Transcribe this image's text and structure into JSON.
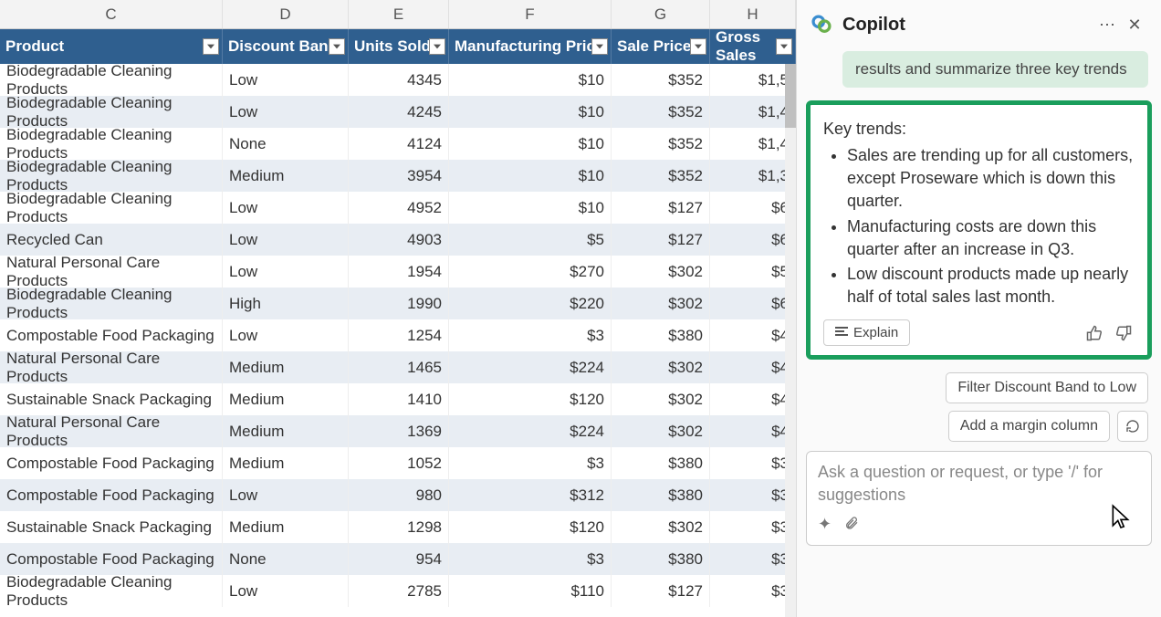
{
  "columns_letters": [
    "C",
    "D",
    "E",
    "F",
    "G",
    "H"
  ],
  "headers": [
    "Product",
    "Discount Band",
    "Units Sold",
    "Manufacturing Price",
    "Sale Price",
    "Gross Sales"
  ],
  "rows": [
    {
      "p": "Biodegradable Cleaning Products",
      "d": "Low",
      "u": "4345",
      "m": "$10",
      "s": "$352",
      "g": "$1,5"
    },
    {
      "p": "Biodegradable Cleaning Products",
      "d": "Low",
      "u": "4245",
      "m": "$10",
      "s": "$352",
      "g": "$1,4"
    },
    {
      "p": "Biodegradable Cleaning Products",
      "d": "None",
      "u": "4124",
      "m": "$10",
      "s": "$352",
      "g": "$1,4"
    },
    {
      "p": "Biodegradable Cleaning Products",
      "d": "Medium",
      "u": "3954",
      "m": "$10",
      "s": "$352",
      "g": "$1,3"
    },
    {
      "p": "Biodegradable Cleaning Products",
      "d": "Low",
      "u": "4952",
      "m": "$10",
      "s": "$127",
      "g": "$6"
    },
    {
      "p": "Recycled Can",
      "d": "Low",
      "u": "4903",
      "m": "$5",
      "s": "$127",
      "g": "$6"
    },
    {
      "p": "Natural Personal Care Products",
      "d": "Low",
      "u": "1954",
      "m": "$270",
      "s": "$302",
      "g": "$5"
    },
    {
      "p": "Biodegradable Cleaning Products",
      "d": "High",
      "u": "1990",
      "m": "$220",
      "s": "$302",
      "g": "$6"
    },
    {
      "p": "Compostable Food Packaging",
      "d": "Low",
      "u": "1254",
      "m": "$3",
      "s": "$380",
      "g": "$4"
    },
    {
      "p": "Natural Personal Care Products",
      "d": "Medium",
      "u": "1465",
      "m": "$224",
      "s": "$302",
      "g": "$4"
    },
    {
      "p": "Sustainable Snack Packaging",
      "d": "Medium",
      "u": "1410",
      "m": "$120",
      "s": "$302",
      "g": "$4"
    },
    {
      "p": "Natural Personal Care Products",
      "d": "Medium",
      "u": "1369",
      "m": "$224",
      "s": "$302",
      "g": "$4"
    },
    {
      "p": "Compostable Food Packaging",
      "d": "Medium",
      "u": "1052",
      "m": "$3",
      "s": "$380",
      "g": "$3"
    },
    {
      "p": "Compostable Food Packaging",
      "d": "Low",
      "u": "980",
      "m": "$312",
      "s": "$380",
      "g": "$3"
    },
    {
      "p": "Sustainable Snack Packaging",
      "d": "Medium",
      "u": "1298",
      "m": "$120",
      "s": "$302",
      "g": "$3"
    },
    {
      "p": "Compostable Food Packaging",
      "d": "None",
      "u": "954",
      "m": "$3",
      "s": "$380",
      "g": "$3"
    },
    {
      "p": "Biodegradable Cleaning Products",
      "d": "Low",
      "u": "2785",
      "m": "$110",
      "s": "$127",
      "g": "$3"
    }
  ],
  "copilot": {
    "title": "Copilot",
    "prompt_prev": "results and summarize three key trends",
    "response_intro": "Key trends:",
    "bullets": [
      "Sales are trending up for all customers, except Proseware which is down this quarter.",
      "Manufacturing costs are down this quarter after an increase in Q3.",
      "Low discount products made up nearly half of total sales last month."
    ],
    "explain": "Explain",
    "suggestion1": "Filter Discount Band to Low",
    "suggestion2": "Add a margin column",
    "placeholder": "Ask a question or request, or type '/' for suggestions"
  }
}
